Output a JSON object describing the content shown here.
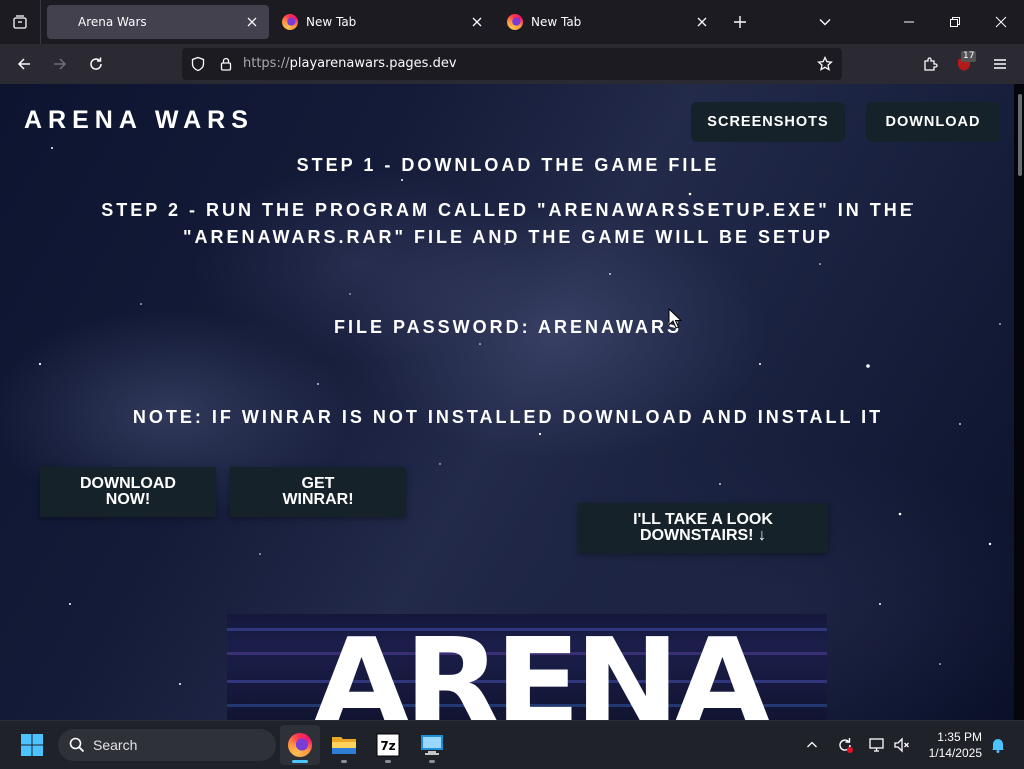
{
  "browser": {
    "tabs": [
      {
        "title": "Arena Wars",
        "active": true
      },
      {
        "title": "New Tab",
        "active": false
      },
      {
        "title": "New Tab",
        "active": false
      }
    ],
    "url_scheme": "https://",
    "url_host": "playarenawars.pages.dev",
    "extension_badge": "17"
  },
  "site": {
    "logo": "ARENA WARS",
    "nav": {
      "screenshots": "SCREENSHOTS",
      "download": "DOWNLOAD"
    },
    "step1": "STEP 1 - DOWNLOAD THE GAME FILE",
    "step2_line1": "STEP 2 - RUN THE PROGRAM CALLED \"ARENAWARSSETUP.EXE\" IN THE",
    "step2_line2": "\"ARENAWARS.RAR\" FILE AND THE GAME WILL BE SETUP",
    "password": "FILE PASSWORD: ARENAWARS",
    "note": "NOTE: IF WINRAR IS NOT INSTALLED DOWNLOAD AND INSTALL IT",
    "buttons": {
      "download_l1": "DOWNLOAD",
      "download_l2": "NOW!",
      "winrar_l1": "GET",
      "winrar_l2": "WINRAR!",
      "downstairs_l1": "I'LL TAKE A LOOK",
      "downstairs_l2": "DOWNSTAIRS! ↓"
    },
    "banner_text": "ARENA"
  },
  "taskbar": {
    "search_label": "Search",
    "time": "1:35 PM",
    "date": "1/14/2025",
    "apps": [
      "firefox-icon",
      "file-explorer-icon",
      "7zip-icon",
      "remote-desktop-icon"
    ]
  },
  "colors": {
    "tab_active": "#42414d",
    "chrome_bg": "#1c1b22",
    "navbar_bg": "#2b2a33",
    "button_bg": "#16222a",
    "taskbar_bg": "#1f2228",
    "accent_blue": "#4cc2ff"
  }
}
